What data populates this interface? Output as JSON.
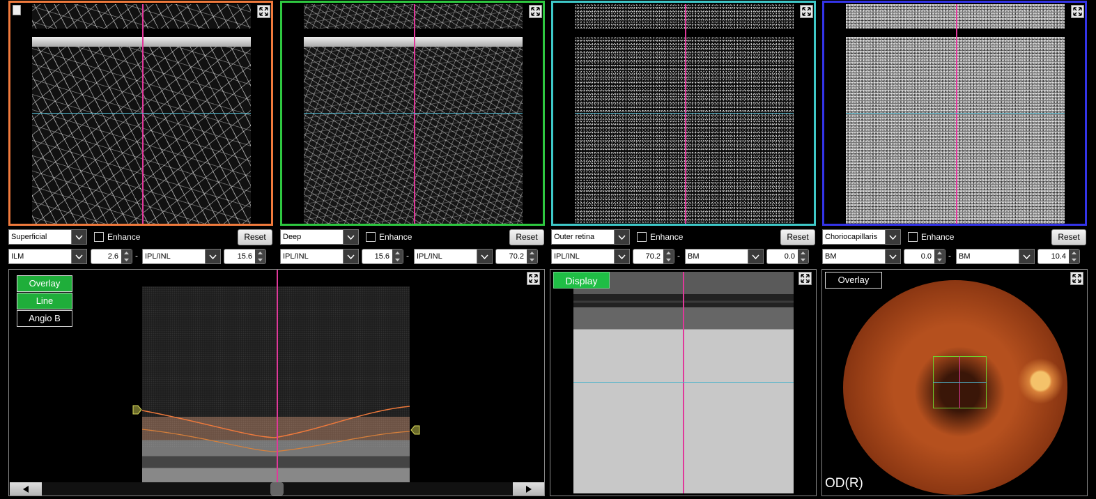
{
  "panels": [
    {
      "layer": "Superficial",
      "enhance_label": "Enhance",
      "reset_label": "Reset",
      "upper_boundary": "ILM",
      "upper_offset": "2.6",
      "lower_boundary": "IPL/INL",
      "lower_offset": "15.6",
      "border_color": "#f07a3c"
    },
    {
      "layer": "Deep",
      "enhance_label": "Enhance",
      "reset_label": "Reset",
      "upper_boundary": "IPL/INL",
      "upper_offset": "15.6",
      "lower_boundary": "IPL/INL",
      "lower_offset": "70.2",
      "border_color": "#2ec840"
    },
    {
      "layer": "Outer retina",
      "enhance_label": "Enhance",
      "reset_label": "Reset",
      "upper_boundary": "IPL/INL",
      "upper_offset": "70.2",
      "lower_boundary": "BM",
      "lower_offset": "0.0",
      "border_color": "#3ec8c8"
    },
    {
      "layer": "Choriocapillaris",
      "enhance_label": "Enhance",
      "reset_label": "Reset",
      "upper_boundary": "BM",
      "upper_offset": "0.0",
      "lower_boundary": "BM",
      "lower_offset": "10.4",
      "border_color": "#3434e8"
    }
  ],
  "separator": "-",
  "bscan_panel": {
    "overlay_label": "Overlay",
    "line_label": "Line",
    "angio_b_label": "Angio B"
  },
  "enface_panel": {
    "display_label": "Display"
  },
  "fundus_panel": {
    "overlay_label": "Overlay",
    "eye_label": "OD(R)"
  },
  "icons": {
    "expand": "expand-icon",
    "dropdown": "chevron-down-icon",
    "spin": "spin-arrows-icon",
    "scroll_left": "arrow-left-icon",
    "scroll_right": "arrow-right-icon",
    "report": "report-icon"
  },
  "colors": {
    "cross_vertical": "#e0389a",
    "cross_horizontal": "#4fb3c9",
    "toggle_on": "#1fae3a"
  }
}
